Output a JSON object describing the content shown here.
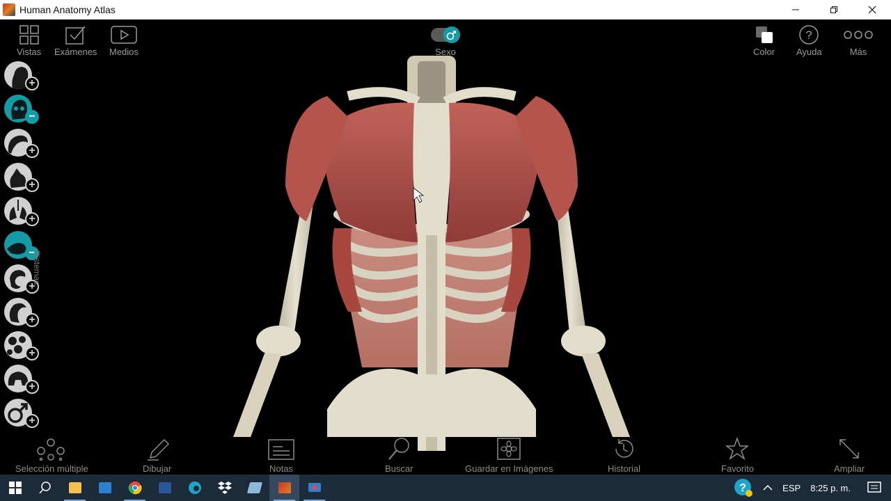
{
  "window": {
    "title": "Human Anatomy Atlas"
  },
  "top_toolbar": {
    "left": [
      {
        "label": "Vistas",
        "icon": "grid-icon"
      },
      {
        "label": "Exámenes",
        "icon": "checkbox-icon"
      },
      {
        "label": "Medios",
        "icon": "play-icon"
      }
    ],
    "center": {
      "label": "Sexo",
      "icon": "male-toggle-icon",
      "state": "male"
    },
    "right": [
      {
        "label": "Color",
        "icon": "color-squares-icon"
      },
      {
        "label": "Ayuda",
        "icon": "help-icon"
      },
      {
        "label": "Más",
        "icon": "more-icon"
      }
    ]
  },
  "systems": {
    "label": "Sistemas",
    "items": [
      {
        "icon": "skin-head-icon",
        "active": false,
        "badge": "+"
      },
      {
        "icon": "skeleton-head-icon",
        "active": true,
        "badge": "−"
      },
      {
        "icon": "connective-icon",
        "active": false,
        "badge": "+"
      },
      {
        "icon": "cardio-icon",
        "active": false,
        "badge": "+"
      },
      {
        "icon": "respiratory-icon",
        "active": false,
        "badge": "+"
      },
      {
        "icon": "muscle-arm-icon",
        "active": true,
        "badge": "−"
      },
      {
        "icon": "digestive-icon",
        "active": false,
        "badge": "+"
      },
      {
        "icon": "nervous-icon",
        "active": false,
        "badge": "+"
      },
      {
        "icon": "lymphatic-icon",
        "active": false,
        "badge": "+"
      },
      {
        "icon": "endocrine-icon",
        "active": false,
        "badge": "+"
      },
      {
        "icon": "male-symbol-icon",
        "active": false,
        "badge": "+"
      }
    ]
  },
  "bottom_toolbar": [
    {
      "label": "Selección múltiple",
      "icon": "multi-select-icon"
    },
    {
      "label": "Dibujar",
      "icon": "pencil-icon"
    },
    {
      "label": "Notas",
      "icon": "notes-icon"
    },
    {
      "label": "Buscar",
      "icon": "search-icon"
    },
    {
      "label": "Guardar en Imágenes",
      "icon": "save-image-icon"
    },
    {
      "label": "Historial",
      "icon": "history-icon"
    },
    {
      "label": "Favorito",
      "icon": "star-icon"
    },
    {
      "label": "Ampliar",
      "icon": "expand-icon"
    }
  ],
  "taskbar": {
    "apps": [
      "start-icon",
      "search-icon",
      "file-explorer-icon",
      "mail-icon",
      "chrome-icon",
      "word-icon",
      "edge-icon",
      "dropbox-icon",
      "notes-app-icon",
      "anatomy-app-icon",
      "screen-recorder-icon"
    ],
    "language": "ESP",
    "time": "8:25 p. m."
  },
  "colors": {
    "accent": "#159ba6",
    "muscle": "#b5534d",
    "bone": "#d9d2bd"
  }
}
